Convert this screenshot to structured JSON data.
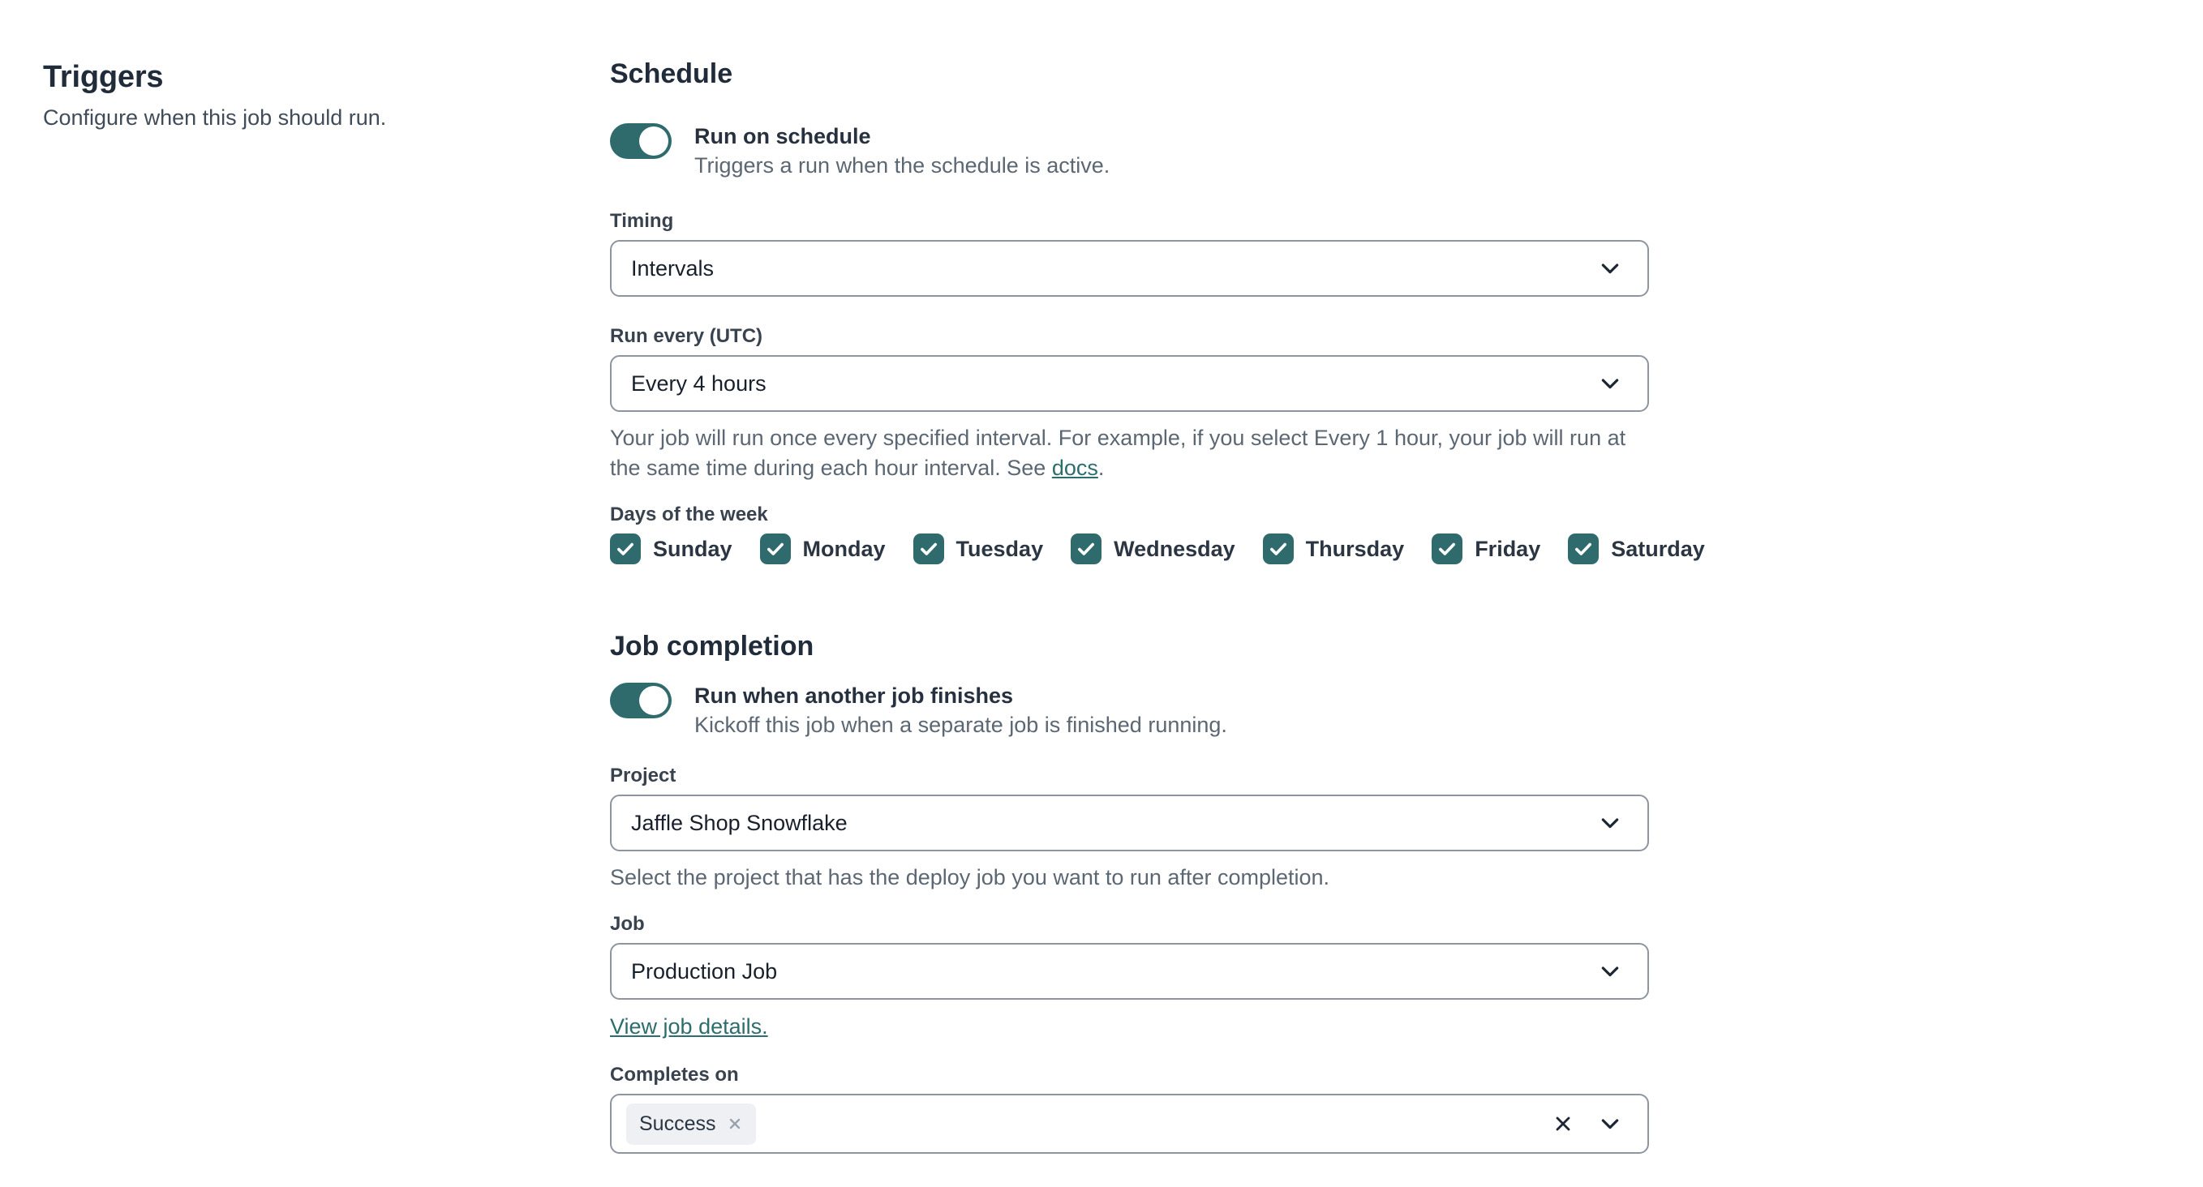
{
  "intro": {
    "title": "Triggers",
    "subtitle": "Configure when this job should run."
  },
  "schedule": {
    "heading": "Schedule",
    "toggle": {
      "label": "Run on schedule",
      "description": "Triggers a run when the schedule is active.",
      "state": "on"
    },
    "timing": {
      "label": "Timing",
      "value": "Intervals"
    },
    "run_every": {
      "label": "Run every (UTC)",
      "value": "Every 4 hours",
      "help_text_before_link": "Your job will run once every specified interval. For example, if you select Every 1 hour, your job will run at the same time during each hour interval. See ",
      "help_link_text": "docs",
      "help_text_after_link": "."
    },
    "days_of_week": {
      "label": "Days of the week",
      "items": [
        {
          "label": "Sunday",
          "checked": true
        },
        {
          "label": "Monday",
          "checked": true
        },
        {
          "label": "Tuesday",
          "checked": true
        },
        {
          "label": "Wednesday",
          "checked": true
        },
        {
          "label": "Thursday",
          "checked": true
        },
        {
          "label": "Friday",
          "checked": true
        },
        {
          "label": "Saturday",
          "checked": true
        }
      ]
    }
  },
  "job_completion": {
    "heading": "Job completion",
    "toggle": {
      "label": "Run when another job finishes",
      "description": "Kickoff this job when a separate job is finished running.",
      "state": "on"
    },
    "project": {
      "label": "Project",
      "value": "Jaffle Shop Snowflake",
      "help_text": "Select the project that has the deploy job you want to run after completion."
    },
    "job": {
      "label": "Job",
      "value": "Production Job",
      "details_link_text": "View job details."
    },
    "completes_on": {
      "label": "Completes on",
      "selected_values": [
        {
          "label": "Success"
        }
      ]
    }
  },
  "colors": {
    "accent_teal": "#2f6a6c",
    "link_teal": "#2c6e6e",
    "field_border": "#8e959f",
    "heading_text": "#212c3b",
    "muted_text": "#5c6774",
    "chip_background": "#eef0f3"
  }
}
